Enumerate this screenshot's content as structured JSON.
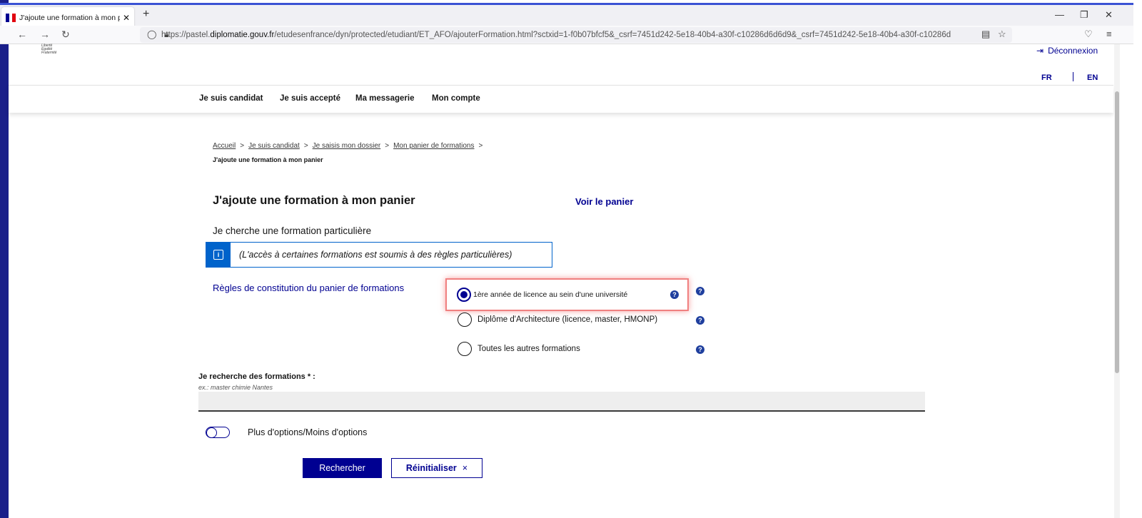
{
  "browser": {
    "tab_title": "J'ajoute une formation à mon p",
    "tab_close": "✕",
    "new_tab": "+",
    "url_prefix": "https://pastel.",
    "url_domain": "diplomatie.gouv.fr",
    "url_rest": "/etudesenfrance/dyn/protected/etudiant/ET_AFO/ajouterFormation.html?sctxid=1-f0b07bfcf5&_csrf=7451d242-5e18-40b4-a30f-c10286d6d6d9&_csrf=7451d242-5e18-40b4-a30f-c10286d",
    "flag_colors": [
      "#000091",
      "#ffffff",
      "#e1000f"
    ]
  },
  "header": {
    "logo_lines": [
      "Liberté",
      "Égalité",
      "Fraternité"
    ],
    "deconnexion": "Déconnexion",
    "lang_fr": "FR",
    "lang_en": "EN"
  },
  "nav": {
    "items": [
      "Je suis candidat",
      "Je suis accepté",
      "Ma messagerie",
      "Mon compte"
    ]
  },
  "breadcrumb": {
    "items": [
      "Accueil",
      "Je suis candidat",
      "Je saisis mon dossier",
      "Mon panier de formations"
    ],
    "separator": ">",
    "current": "J'ajoute une formation à mon panier"
  },
  "main": {
    "title": "J'ajoute une formation à mon panier",
    "voir_panier": "Voir le panier",
    "subtitle": "Je cherche une formation particulière",
    "info_text": "(L'accès à certaines formations est soumis à des règles particulières)",
    "info_icon": "i",
    "regles_link": "Règles de constitution du panier de formations",
    "options": [
      {
        "label": "1ère année de licence au sein d'une université",
        "checked": true
      },
      {
        "label": "Diplôme d'Architecture (licence, master, HMONP)",
        "checked": false
      },
      {
        "label": "Toutes les autres formations",
        "checked": false
      }
    ],
    "help_glyph": "?",
    "search_label": "Je recherche des formations * :",
    "search_hint": "ex.: master chimie Nantes",
    "search_value": "",
    "toggle_label": "Plus d'options/Moins d'options",
    "btn_search": "Rechercher",
    "btn_reset": "Réinitialiser",
    "btn_reset_icon": "×"
  },
  "colors": {
    "primary": "#000091",
    "info": "#0063cb",
    "highlight": "#f08080"
  }
}
